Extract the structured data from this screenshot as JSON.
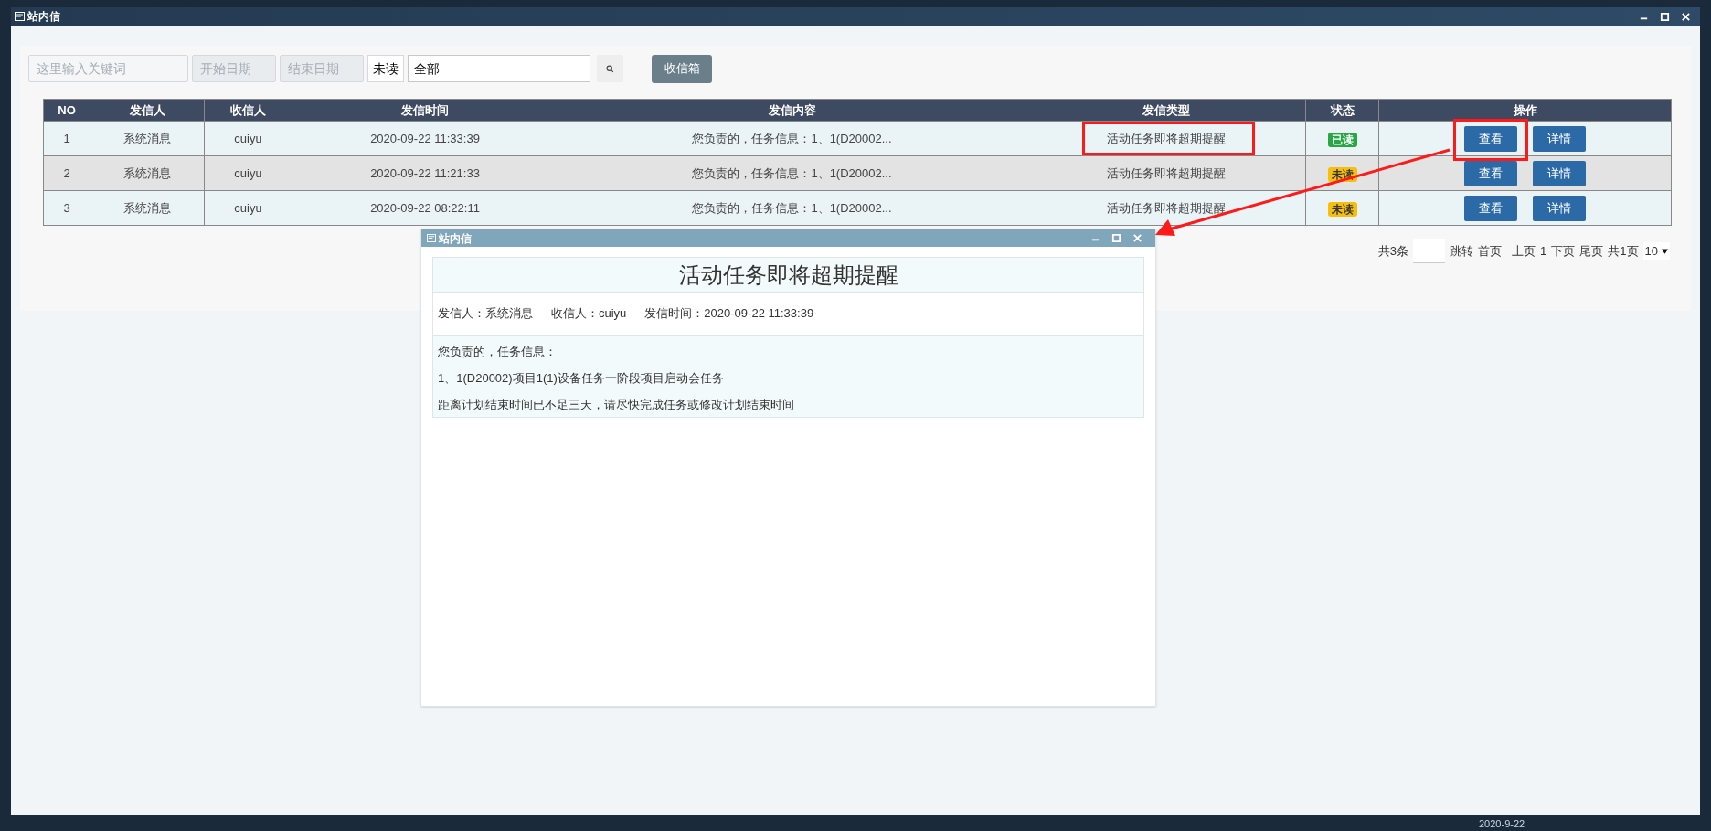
{
  "window": {
    "title": "站内信"
  },
  "toolbar": {
    "keyword": {
      "placeholder": "这里输入关键词"
    },
    "start_date": {
      "placeholder": "开始日期"
    },
    "end_date": {
      "placeholder": "结束日期"
    },
    "read_label": "未读",
    "read_filter": {
      "value": "全部"
    },
    "inbox_button": "收信箱"
  },
  "table": {
    "columns": [
      "NO",
      "发信人",
      "收信人",
      "发信时间",
      "发信内容",
      "发信类型",
      "状态",
      "操作"
    ],
    "rows": [
      {
        "no": "1",
        "sender": "系统消息",
        "recipient": "cuiyu",
        "time": "2020-09-22 11:33:39",
        "content": "您负责的，任务信息：1、1(D20002...",
        "type": "活动任务即将超期提醒",
        "status": {
          "text": "已读",
          "kind": "read"
        },
        "actions": [
          "查看",
          "详情"
        ]
      },
      {
        "no": "2",
        "sender": "系统消息",
        "recipient": "cuiyu",
        "time": "2020-09-22 11:21:33",
        "content": "您负责的，任务信息：1、1(D20002...",
        "type": "活动任务即将超期提醒",
        "status": {
          "text": "未读",
          "kind": "unread"
        },
        "actions": [
          "查看",
          "详情"
        ]
      },
      {
        "no": "3",
        "sender": "系统消息",
        "recipient": "cuiyu",
        "time": "2020-09-22 08:22:11",
        "content": "您负责的，任务信息：1、1(D20002...",
        "type": "活动任务即将超期提醒",
        "status": {
          "text": "未读",
          "kind": "unread"
        },
        "actions": [
          "查看",
          "详情"
        ]
      }
    ]
  },
  "pagination": {
    "total": "共3条",
    "jump": "跳转",
    "first": "首页",
    "prev": "上页",
    "current": "1",
    "next": "下页",
    "last": "尾页",
    "pages": "共1页",
    "page_size": "10"
  },
  "dialog": {
    "title": "站内信",
    "heading": "活动任务即将超期提醒",
    "meta": [
      "发信人：系统消息",
      "收信人：cuiyu",
      "发信时间：2020-09-22 11:33:39"
    ],
    "body": [
      "您负责的，任务信息：",
      "1、1(D20002)项目1(1)设备任务一阶段项目启动会任务",
      "距离计划结束时间已不足三天，请尽快完成任务或修改计划结束时间"
    ]
  },
  "taskbar": {
    "date": "2020-9-22"
  }
}
